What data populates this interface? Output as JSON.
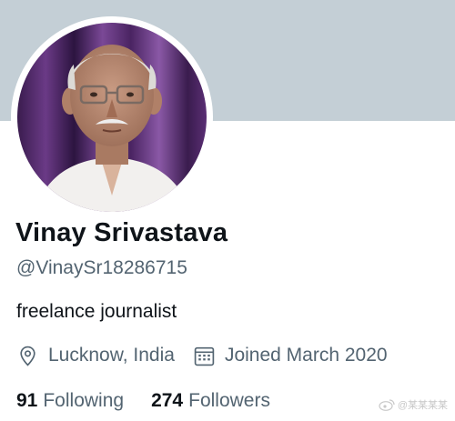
{
  "profile": {
    "display_name": "Vinay Srivastava",
    "handle": "@VinaySr18286715",
    "bio": "freelance journalist",
    "location": "Lucknow, India",
    "location_icon": "location-pin-icon",
    "joined": "Joined March 2020",
    "joined_icon": "calendar-icon"
  },
  "stats": {
    "following_count": "91",
    "following_label": "Following",
    "followers_count": "274",
    "followers_label": "Followers"
  },
  "watermark": {
    "text": "@某某某某"
  },
  "colors": {
    "banner": "#c4cfd6",
    "primary_text": "#0f1419",
    "secondary_text": "#536471",
    "background": "#ffffff"
  }
}
